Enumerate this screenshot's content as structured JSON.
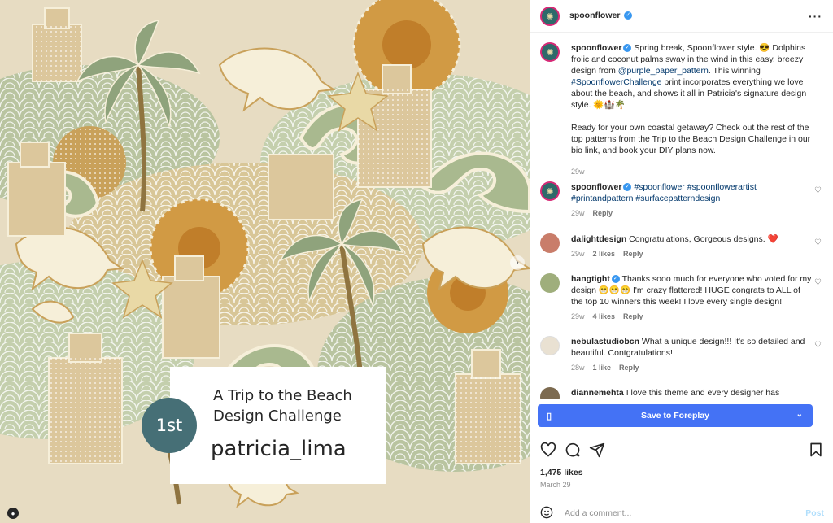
{
  "post_image": {
    "card_title": "A Trip to the Beach Design Challenge",
    "badge": "1st",
    "designer": "patricia_lima",
    "colors": {
      "sand": "#e7dcc2",
      "green": "#aab894",
      "ochre": "#c9a15a",
      "cream": "#f6efd9",
      "badge": "#466f76"
    }
  },
  "header": {
    "username": "spoonflower",
    "more_icon": "more-horizontal-icon"
  },
  "caption": {
    "username": "spoonflower",
    "text_1": "Spring break, Spoonflower style. 😎 Dolphins frolic and coconut palms sway in the wind in this easy, breezy design from",
    "mention": "@purple_paper_pattern",
    "text_2": ". This winning",
    "hashtag": "#SpoonflowerChallenge",
    "text_3": "print incorporates everything we love about the beach, and shows it all in Patricia's signature design style. 🌞🏰🌴",
    "text_4": "Ready for your own coastal getaway? Check out the rest of the top patterns from the Trip to the Beach Design Challenge in our bio link, and book your DIY plans now.",
    "time": "29w"
  },
  "comments": [
    {
      "username": "spoonflower",
      "text": "#spoonflower #spoonflowerartist #printandpattern #surfacepatterndesign",
      "time": "29w",
      "likes": "",
      "reply": "Reply"
    },
    {
      "username": "dalightdesign",
      "text": "Congratulations, Gorgeous designs. ❤️",
      "time": "29w",
      "likes": "2 likes",
      "reply": "Reply"
    },
    {
      "username": "hangtight",
      "text": "Thanks sooo much for everyone who voted for my design 😁😁😁 I'm crazy flattered! HUGE congrats to ALL of the top 10 winners this week! I love every single design!",
      "time": "29w",
      "likes": "4 likes",
      "reply": "Reply"
    },
    {
      "username": "nebulastudiobcn",
      "text": "What a unique design!!! It's so detailed and beautiful. Contgratulations!",
      "time": "28w",
      "likes": "1 like",
      "reply": "Reply"
    },
    {
      "username": "diannemehta",
      "text": "I love this theme and every designer has",
      "time": "",
      "likes": "",
      "reply": ""
    }
  ],
  "save_button": {
    "label": "Save to Foreplay",
    "color": "#4472f5"
  },
  "actions": {
    "likes": "1,475 likes",
    "date": "March 29"
  },
  "add_comment": {
    "placeholder": "Add a comment...",
    "post": "Post"
  }
}
